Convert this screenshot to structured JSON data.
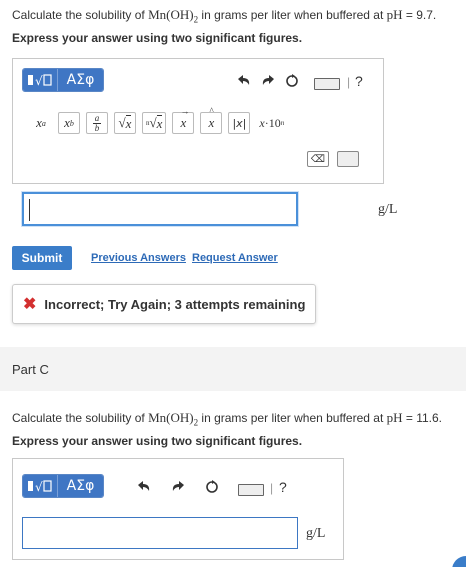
{
  "partB": {
    "question_prefix": "Calculate the solubility of ",
    "question_formula": "Mn(OH)",
    "question_subscript": "2",
    "question_suffix": " in grams per liter when buffered at ",
    "question_ph_label": "pH",
    "question_ph_value": " = 9.7.",
    "instruction": "Express your answer using two significant figures.",
    "toolbar": {
      "greek_label": "ΑΣφ",
      "help_label": "?"
    },
    "templates": [
      "xᵃ",
      "x_b",
      "a/b",
      "√x",
      "ⁿ√x",
      "x̄",
      "x̂",
      "|x|",
      "x·10ⁿ"
    ],
    "answer_value": "",
    "unit": "g/L",
    "submit_label": "Submit",
    "previous_answers_label": "Previous Answers",
    "request_answer_label": "Request Answer",
    "feedback_text": "Incorrect; Try Again; 3 attempts remaining"
  },
  "partC": {
    "label": "Part C",
    "question_prefix": "Calculate the solubility of ",
    "question_formula": "Mn(OH)",
    "question_subscript": "2",
    "question_suffix": " in grams per liter when buffered at ",
    "question_ph_label": "pH",
    "question_ph_value": " = 11.6.",
    "instruction": "Express your answer using two significant figures.",
    "toolbar": {
      "greek_label": "ΑΣφ",
      "help_label": "?"
    },
    "answer_value": "",
    "unit": "g/L"
  },
  "colors": {
    "accent": "#3a7dc9",
    "link": "#2d6ab7",
    "error": "#d32f2f"
  }
}
